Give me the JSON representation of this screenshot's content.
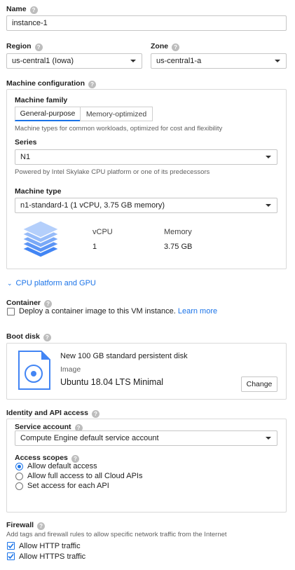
{
  "name": {
    "label": "Name",
    "value": "instance-1"
  },
  "region": {
    "label": "Region",
    "value": "us-central1 (Iowa)"
  },
  "zone": {
    "label": "Zone",
    "value": "us-central1-a"
  },
  "machine_config": {
    "label": "Machine configuration",
    "family_label": "Machine family",
    "tabs": [
      "General-purpose",
      "Memory-optimized"
    ],
    "family_desc": "Machine types for common workloads, optimized for cost and flexibility",
    "series_label": "Series",
    "series_value": "N1",
    "series_desc": "Powered by Intel Skylake CPU platform or one of its predecessors",
    "type_label": "Machine type",
    "type_value": "n1-standard-1 (1 vCPU, 3.75 GB memory)",
    "vcpu_header": "vCPU",
    "memory_header": "Memory",
    "vcpu_value": "1",
    "memory_value": "3.75 GB"
  },
  "cpu_platform_link": "CPU platform and GPU",
  "container": {
    "label": "Container",
    "checkbox_text": "Deploy a container image to this VM instance.",
    "learn_more": "Learn more"
  },
  "boot_disk": {
    "label": "Boot disk",
    "title": "New 100 GB standard persistent disk",
    "image_label": "Image",
    "image_value": "Ubuntu 18.04 LTS Minimal",
    "change_button": "Change"
  },
  "identity": {
    "label": "Identity and API access",
    "service_account_label": "Service account",
    "service_account_value": "Compute Engine default service account",
    "scopes_label": "Access scopes",
    "scopes": [
      "Allow default access",
      "Allow full access to all Cloud APIs",
      "Set access for each API"
    ]
  },
  "firewall": {
    "label": "Firewall",
    "desc": "Add tags and firewall rules to allow specific network traffic from the Internet",
    "options": [
      "Allow HTTP traffic",
      "Allow HTTPS traffic"
    ]
  },
  "icons": {
    "help": "?",
    "expand": "chevron-down-icon"
  },
  "colors": {
    "accent": "#1a73e8",
    "stack": "#4285f4"
  }
}
